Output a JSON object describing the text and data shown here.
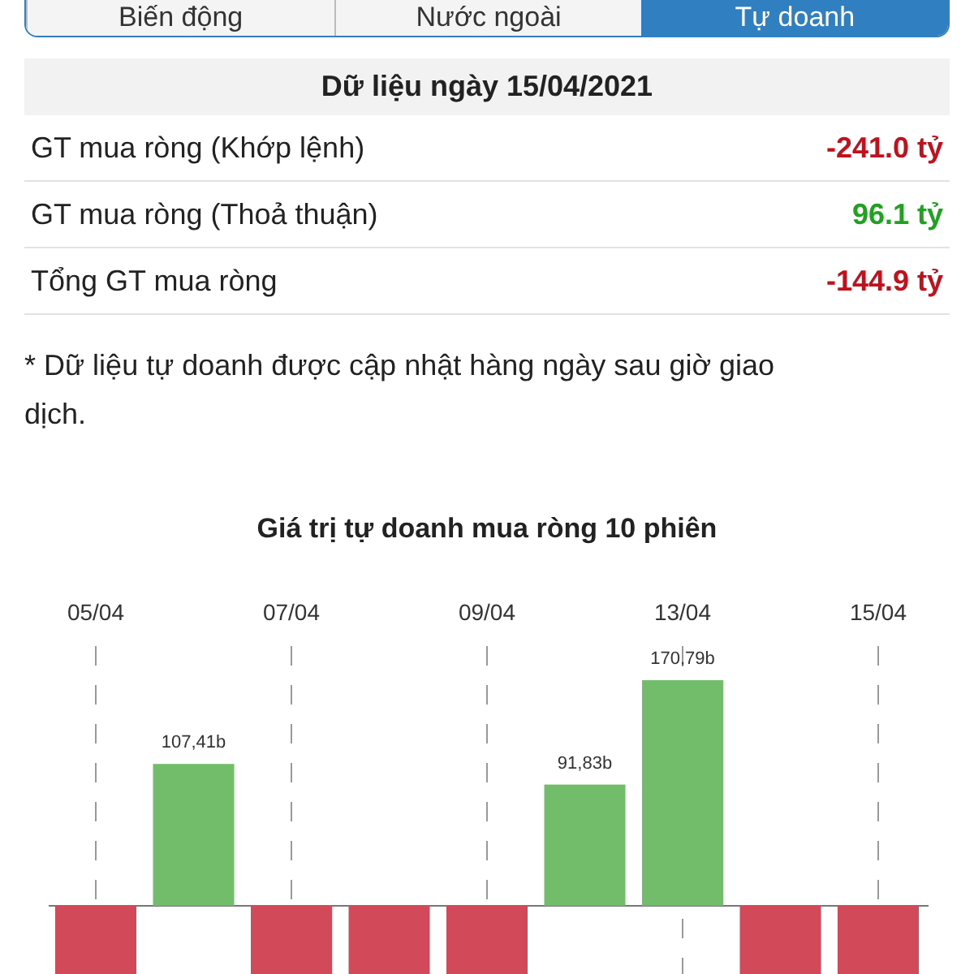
{
  "tabs": [
    {
      "label": "Biến động",
      "selected": false
    },
    {
      "label": "Nước ngoài",
      "selected": false
    },
    {
      "label": "Tự doanh",
      "selected": true
    }
  ],
  "summary": {
    "title": "Dữ liệu ngày 15/04/2021",
    "rows": [
      {
        "label": "GT mua ròng (Khớp lệnh)",
        "value": "-241.0 tỷ",
        "color": "#c0111d"
      },
      {
        "label": "GT mua ròng (Thoả thuận)",
        "value": "96.1 tỷ",
        "color": "#1fa21f"
      },
      {
        "label": "Tổng GT mua ròng",
        "value": "-144.9 tỷ",
        "color": "#c0111d"
      }
    ]
  },
  "note": "* Dữ liệu tự doanh được cập nhật hàng ngày sau giờ giao dịch.",
  "chart": {
    "title": "Giá trị tự doanh mua ròng 10 phiên",
    "date_labels": [
      "05/04",
      "07/04",
      "09/04",
      "13/04",
      "15/04"
    ],
    "value_labels": [
      "107,41b",
      "91,83b",
      "170,79b"
    ]
  }
}
